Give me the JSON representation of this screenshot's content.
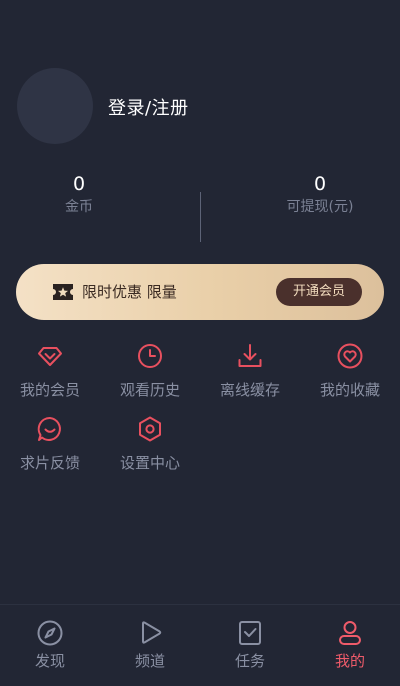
{
  "profile": {
    "login_label": "登录/注册"
  },
  "stats": {
    "coins": {
      "value": "0",
      "label": "金币"
    },
    "cash": {
      "value": "0",
      "label": "可提现(元)"
    }
  },
  "vip_banner": {
    "text": "限时优惠 限量",
    "button_label": "开通会员",
    "icon": "ticket-star-icon"
  },
  "menu": {
    "items": [
      {
        "label": "我的会员",
        "icon": "diamond-icon"
      },
      {
        "label": "观看历史",
        "icon": "clock-icon"
      },
      {
        "label": "离线缓存",
        "icon": "download-icon"
      },
      {
        "label": "我的收藏",
        "icon": "heart-icon"
      },
      {
        "label": "求片反馈",
        "icon": "chat-bubble-icon"
      },
      {
        "label": "设置中心",
        "icon": "settings-hexagon-icon"
      }
    ]
  },
  "tabbar": {
    "active": "我的",
    "tabs": [
      {
        "label": "发现",
        "icon": "compass-icon"
      },
      {
        "label": "频道",
        "icon": "play-icon"
      },
      {
        "label": "任务",
        "icon": "task-bookmark-icon"
      },
      {
        "label": "我的",
        "icon": "user-icon"
      }
    ]
  },
  "colors": {
    "background": "#222634",
    "accent": "#ef5b6a",
    "muted_text": "#8a90a3",
    "vip_gold": "#e9cfa8",
    "vip_button": "#4a302c"
  }
}
